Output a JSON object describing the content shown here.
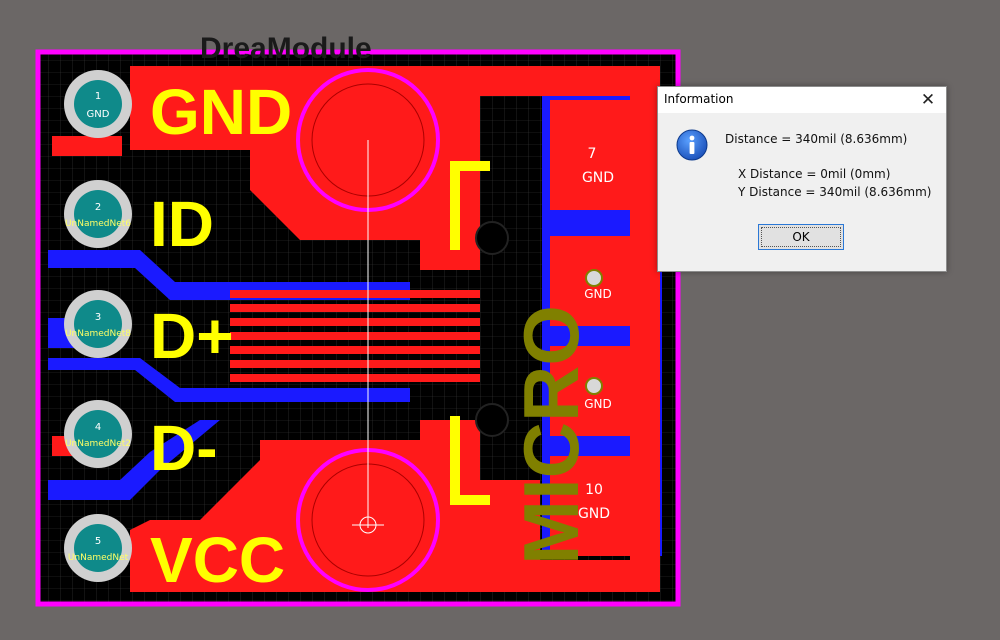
{
  "watermark": "DreaModule",
  "pcb": {
    "silkscreen_left": [
      "GND",
      "ID",
      "D+",
      "D-",
      "VCC"
    ],
    "silkscreen_right": "MICRO",
    "pins": [
      {
        "num": "1",
        "net": "GND"
      },
      {
        "num": "2",
        "net": "UnNamedNet6"
      },
      {
        "num": "3",
        "net": "UnNamedNet8"
      },
      {
        "num": "4",
        "net": "UnNamedNet2"
      },
      {
        "num": "5",
        "net": "UnNamedNet"
      }
    ],
    "pads_right": [
      {
        "num": "7",
        "net": "GND"
      },
      {
        "num": "",
        "net": "GND"
      },
      {
        "num": "",
        "net": "GND"
      },
      {
        "num": "10",
        "net": "GND"
      }
    ],
    "colors": {
      "top_copper": "#ff1a1a",
      "bottom_copper": "#1a1aff",
      "silk_top": "#ffff00",
      "silk_bottom": "#808000",
      "board_outline": "#ff00ff",
      "background": "#000000"
    }
  },
  "dialog": {
    "title": "Information",
    "distance": "Distance = 340mil (8.636mm)",
    "x_distance": "X Distance = 0mil (0mm)",
    "y_distance": "Y Distance = 340mil (8.636mm)",
    "ok_label": "OK",
    "icon": "info-icon",
    "close_icon": "close-icon"
  }
}
